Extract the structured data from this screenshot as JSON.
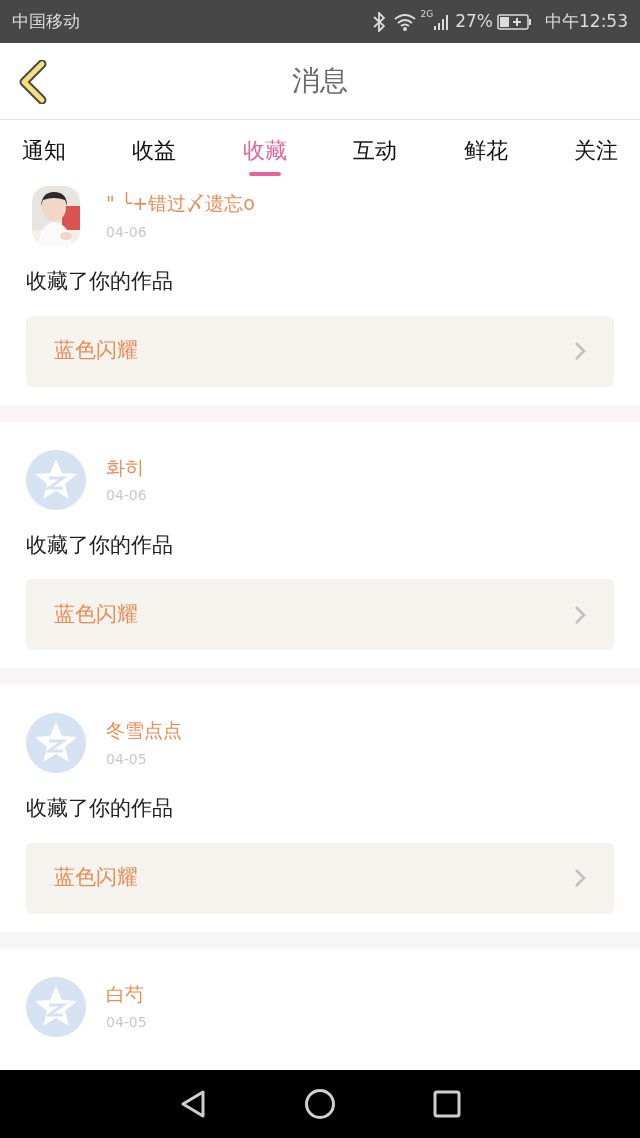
{
  "status_bar": {
    "carrier": "中国移动",
    "network": "2G",
    "battery": "27%",
    "time": "中午12:53"
  },
  "header": {
    "title": "消息"
  },
  "tabs": [
    {
      "label": "通知",
      "selected": false
    },
    {
      "label": "收益",
      "selected": false
    },
    {
      "label": "收藏",
      "selected": true
    },
    {
      "label": "互动",
      "selected": false
    },
    {
      "label": "鲜花",
      "selected": false
    },
    {
      "label": "关注",
      "selected": false
    }
  ],
  "messages": [
    {
      "name": "\" ╰+错过〆遗忘o",
      "date": "04-06",
      "text": "收藏了你的作品",
      "work": "蓝色闪耀"
    },
    {
      "avatar": {
        "kind": "default"
      },
      "name": "화히",
      "date": "04-06",
      "text": "收藏了你的作品",
      "work": "蓝色闪耀"
    },
    {
      "avatar": {
        "kind": "default"
      },
      "name": "冬雪点点",
      "date": "04-05",
      "text": "收藏了你的作品",
      "work": "蓝色闪耀"
    },
    {
      "avatar": {
        "kind": "default"
      },
      "name": "白芍",
      "date": "04-05"
    }
  ]
}
